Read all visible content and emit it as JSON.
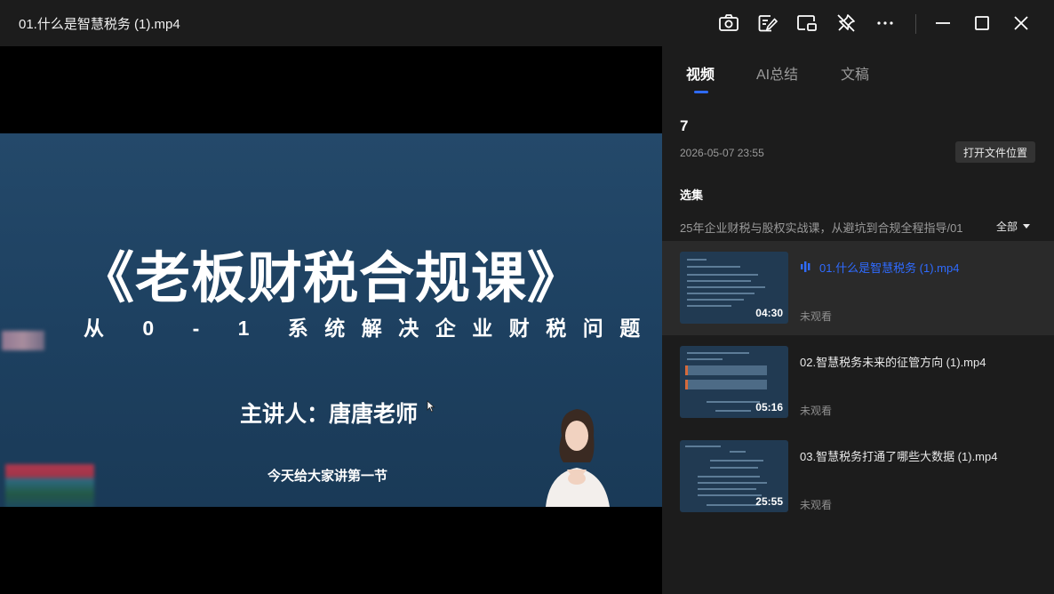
{
  "window": {
    "title": "01.什么是智慧税务 (1).mp4"
  },
  "toolbar": {
    "icons": [
      "camera-icon",
      "note-edit-icon",
      "picture-in-picture-icon",
      "pin-off-icon",
      "more-icon",
      "minimize-icon",
      "maximize-icon",
      "close-icon"
    ]
  },
  "slide": {
    "title": "《老板财税合规课》",
    "subtitle": "从 0 - 1 系统解决企业财税问题",
    "speaker": "主讲人：唐唐老师",
    "lesson": "今天给大家讲第一节"
  },
  "sidebar": {
    "tabs": [
      "视频",
      "AI总结",
      "文稿"
    ],
    "active_tab": "视频",
    "folder_name": "7",
    "folder_date": "2026-05-07 23:55",
    "open_location_label": "打开文件位置",
    "selection_label": "选集",
    "course_name": "25年企业财税与股权实战课，从避坑到合规全程指导/01",
    "filter_label": "全部",
    "episodes": [
      {
        "title": "01.什么是智慧税务 (1).mp4",
        "duration": "04:30",
        "status": "未观看",
        "playing": true
      },
      {
        "title": "02.智慧税务未来的征管方向 (1).mp4",
        "duration": "05:16",
        "status": "未观看",
        "playing": false
      },
      {
        "title": "03.智慧税务打通了哪些大数据 (1).mp4",
        "duration": "25:55",
        "status": "未观看",
        "playing": false
      }
    ]
  },
  "colors": {
    "accent": "#2f6bff",
    "panel": "#1c1c1c",
    "active_row": "#2a2a2a"
  }
}
